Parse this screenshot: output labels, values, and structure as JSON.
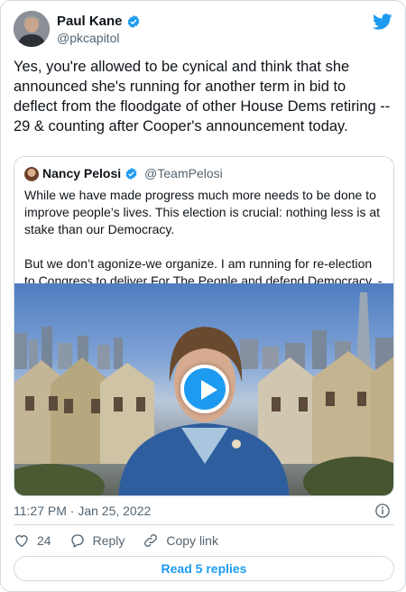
{
  "author": {
    "name": "Paul Kane",
    "handle": "@pkcapitol",
    "verified": true
  },
  "tweet": {
    "text": "Yes, you're allowed to be cynical and think that she announced she's running for another term in bid to deflect from the floodgate of other House Dems retiring -- 29 & counting after Cooper's announcement today."
  },
  "quoted": {
    "name": "Nancy Pelosi",
    "handle": "@TeamPelosi",
    "verified": true,
    "text": "While we have made progress much more needs to be done to improve people’s lives. This election is crucial: nothing less is at stake than our Democracy.\n\nBut we don’t agonize-we organize. I am running for re-election to Congress to deliver For The People and defend Democracy. -NP"
  },
  "meta": {
    "timestamp": "11:27 PM · Jan 25, 2022"
  },
  "actions": {
    "like_count": "24",
    "reply_label": "Reply",
    "copy_label": "Copy link"
  },
  "replies_button": "Read 5 replies",
  "colors": {
    "accent": "#1d9bf0",
    "text": "#0f1419",
    "secondary": "#536471",
    "border": "#cfd9de"
  },
  "icons": [
    "twitter-bird-icon",
    "verified-badge-icon",
    "info-icon",
    "heart-icon",
    "reply-icon",
    "link-icon",
    "play-icon"
  ]
}
